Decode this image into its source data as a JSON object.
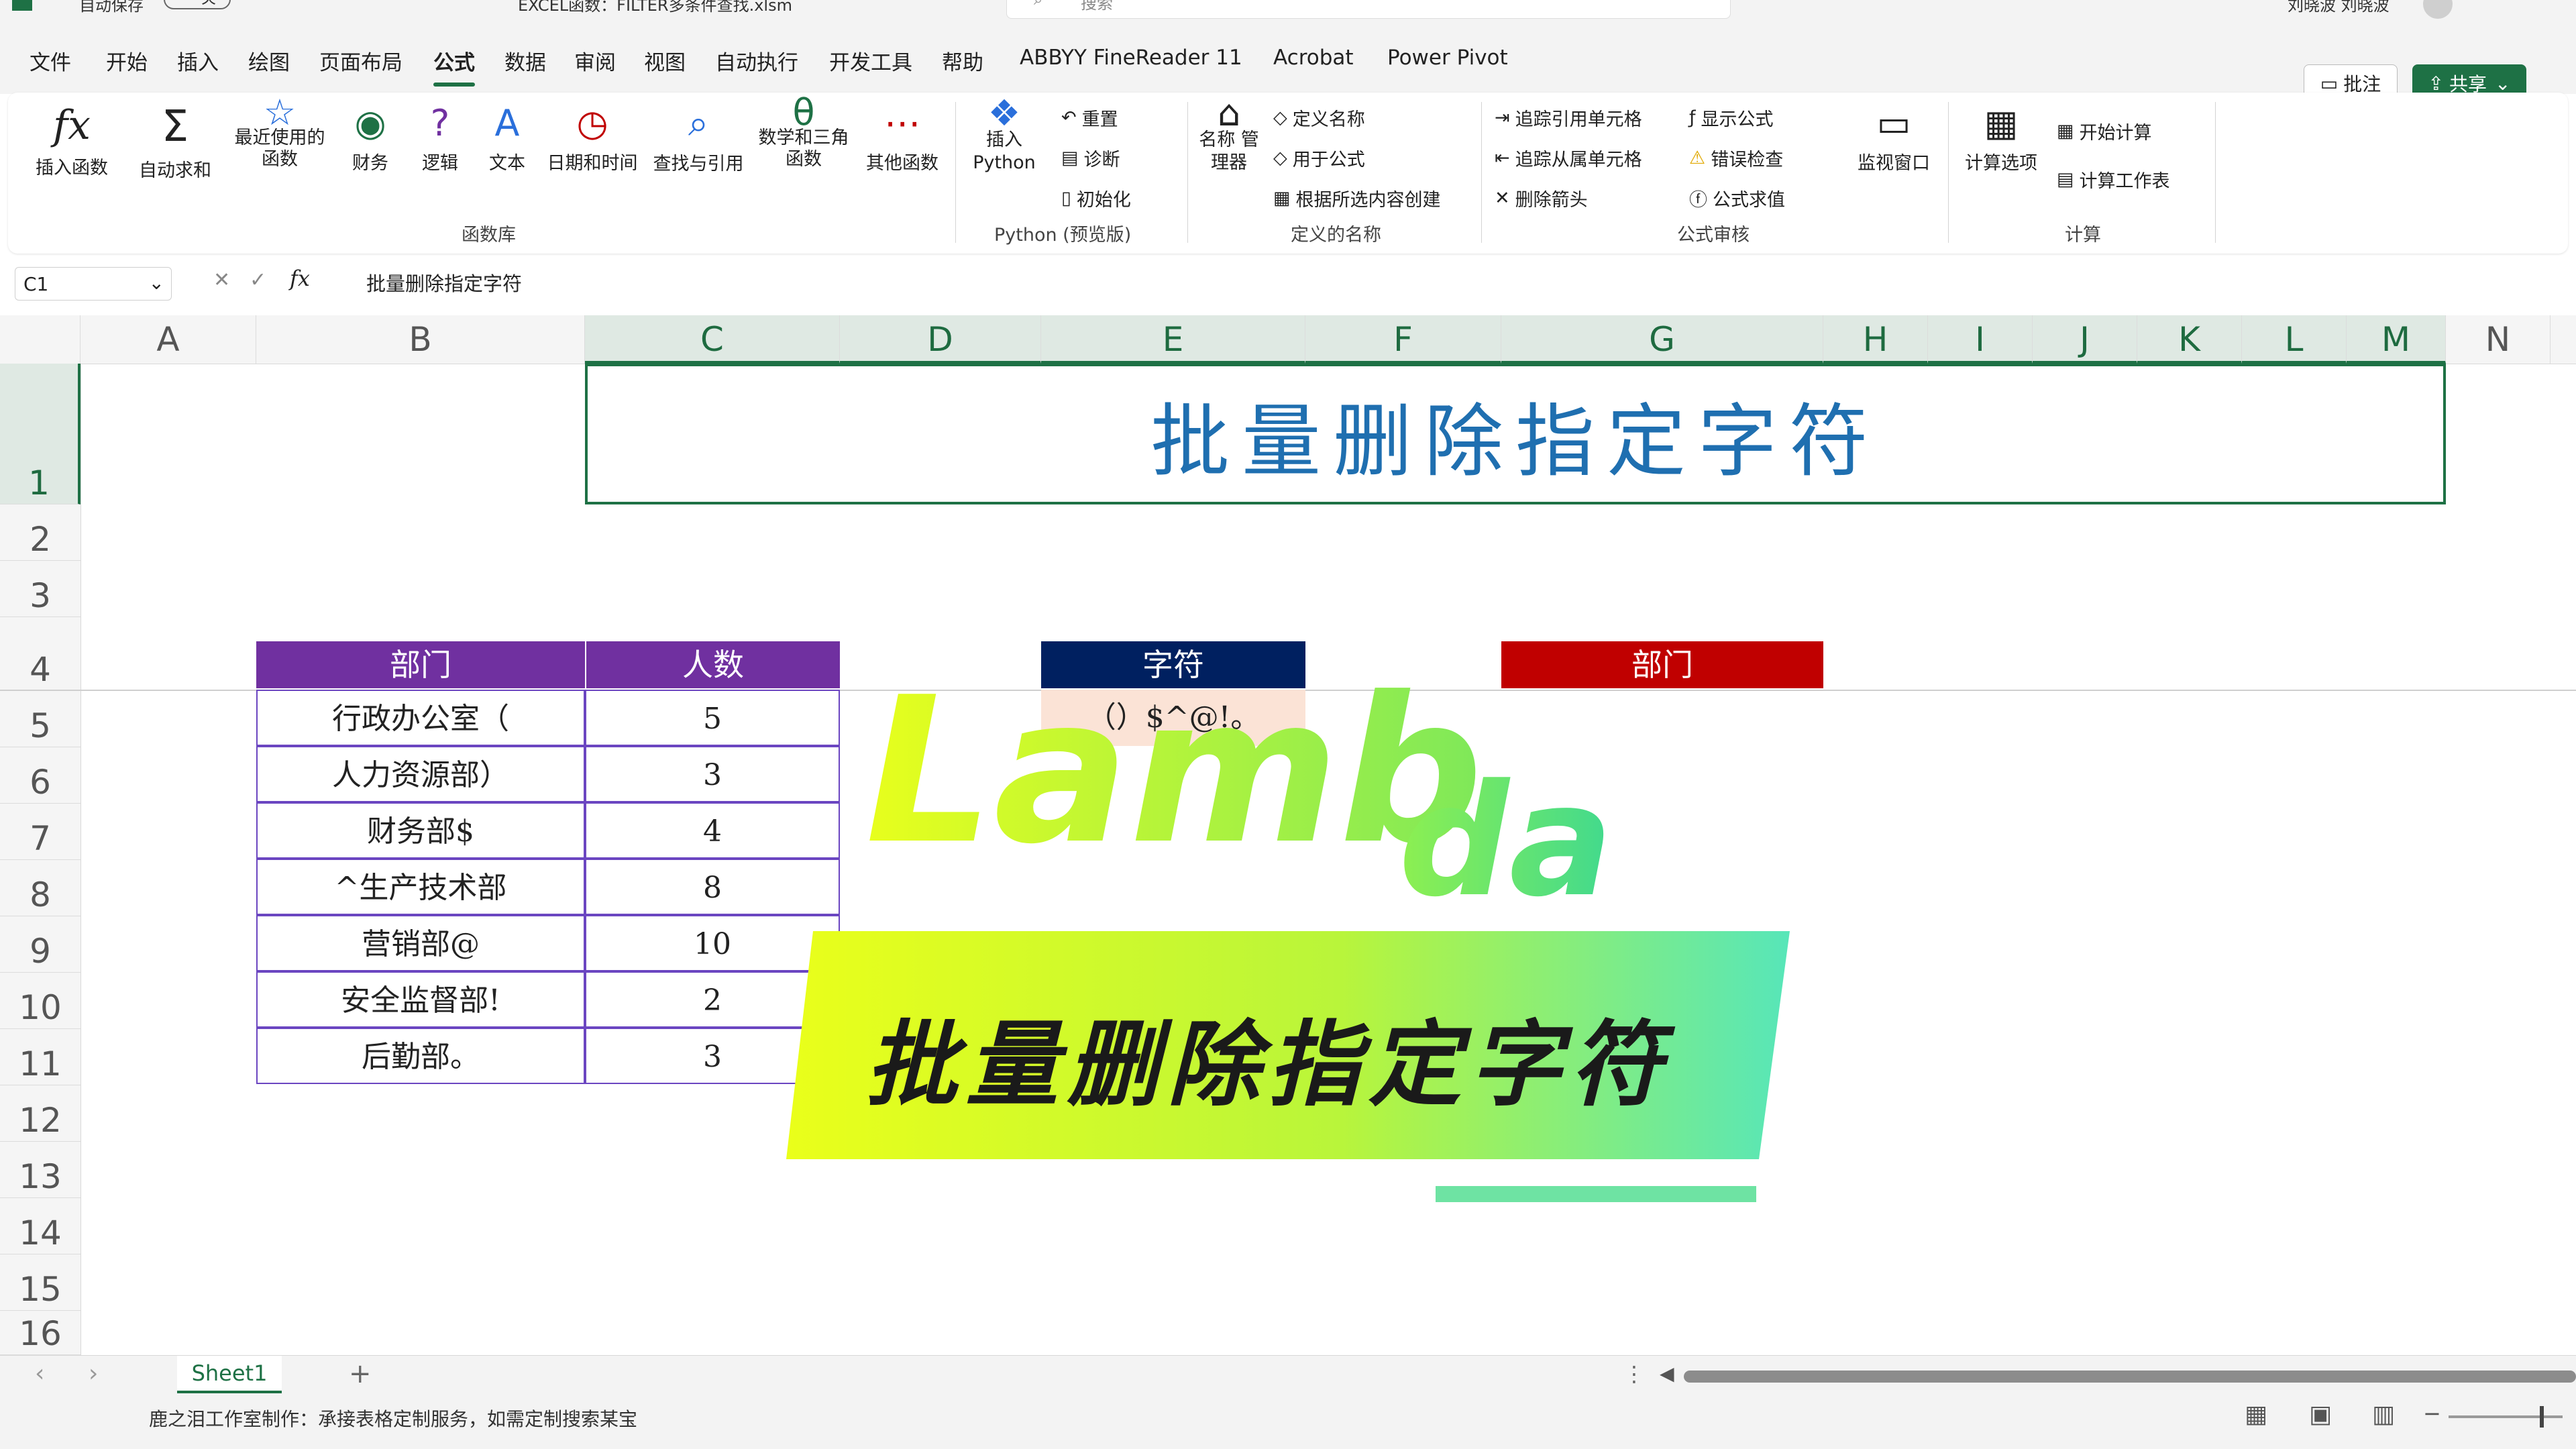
{
  "title_bar": {
    "autosave": "自动保存",
    "toggle_state": "关",
    "file_name": "EXCEL函数：FILTER多条件查找.xlsm",
    "search_placeholder": "搜索",
    "user_name": "刘晓波 刘晓波"
  },
  "menu": {
    "items": [
      "文件",
      "开始",
      "插入",
      "绘图",
      "页面布局",
      "公式",
      "数据",
      "审阅",
      "视图",
      "自动执行",
      "开发工具",
      "帮助",
      "ABBYY FineReader 11",
      "Acrobat",
      "Power Pivot"
    ],
    "active": "公式",
    "comment_button": "批注",
    "share_button": "共享"
  },
  "ribbon": {
    "function_library": {
      "group_label": "函数库",
      "buttons": [
        "插入函数",
        "自动求和",
        "最近使用的函数",
        "财务",
        "逻辑",
        "文本",
        "日期和时间",
        "查找与引用",
        "数学和三角函数",
        "其他函数"
      ]
    },
    "python": {
      "group_label": "Python (预览版)",
      "insert_python": "插入 Python",
      "reset": "重置",
      "diagnose": "诊断",
      "initialize": "初始化"
    },
    "defined_names": {
      "group_label": "定义的名称",
      "name_manager": "名称 管理器",
      "define_name": "定义名称",
      "use_in_formula": "用于公式",
      "create_from_selection": "根据所选内容创建"
    },
    "formula_auditing": {
      "group_label": "公式审核",
      "trace_precedents": "追踪引用单元格",
      "trace_dependents": "追踪从属单元格",
      "remove_arrows": "删除箭头",
      "show_formulas": "显示公式",
      "error_checking": "错误检查",
      "evaluate_formula": "公式求值",
      "watch_window": "监视窗口"
    },
    "calculation": {
      "group_label": "计算",
      "calc_options": "计算选项",
      "calc_now": "开始计算",
      "calc_sheet": "计算工作表"
    }
  },
  "formula_bar": {
    "name_box": "C1",
    "fx": "fx",
    "value": "批量删除指定字符"
  },
  "grid": {
    "columns": [
      "A",
      "B",
      "C",
      "D",
      "E",
      "F",
      "G",
      "H",
      "I",
      "J",
      "K",
      "L",
      "M",
      "N"
    ],
    "rows": [
      "1",
      "2",
      "3",
      "4",
      "5",
      "6",
      "7",
      "8",
      "9",
      "10",
      "11",
      "12",
      "13",
      "14",
      "15",
      "16"
    ]
  },
  "sheet_title": "批量删除指定字符",
  "table": {
    "headers": [
      "部门",
      "人数"
    ],
    "rows": [
      [
        "行政办公室（",
        "5"
      ],
      [
        "人力资源部）",
        "3"
      ],
      [
        "财务部$",
        "4"
      ],
      [
        "^生产技术部",
        "8"
      ],
      [
        "营销部@",
        "10"
      ],
      [
        "安全监督部!",
        "2"
      ],
      [
        "后勤部。",
        "3"
      ]
    ]
  },
  "chars_box": {
    "header": "字符",
    "value": "（）$^@!。"
  },
  "result_box": {
    "header": "部门"
  },
  "overlay": {
    "word_part1": "Lamb",
    "word_part2": "da",
    "banner_text": "批量删除指定字符"
  },
  "sheet_tabs": {
    "active": "Sheet1",
    "add": "+"
  },
  "status_bar": {
    "message": "鹿之泪工作室制作：承接表格定制服务，如需定制搜索某宝"
  },
  "colors": {
    "excel_green": "#1e7145",
    "header_purple": "#7030a0",
    "header_navy": "#002060",
    "header_red": "#c00000",
    "title_blue": "#1f6fb0"
  }
}
